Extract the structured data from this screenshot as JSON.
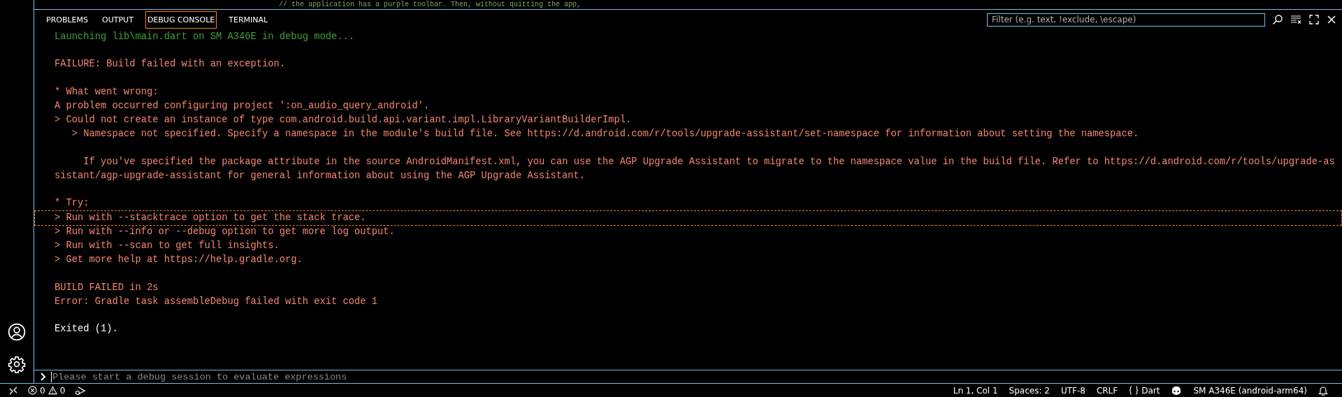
{
  "editor": {
    "code_line": "// the application has a purple toolbar. Then, without quitting the app,"
  },
  "panel": {
    "tabs": [
      {
        "label": "PROBLEMS",
        "selected": false
      },
      {
        "label": "OUTPUT",
        "selected": false
      },
      {
        "label": "DEBUG CONSOLE",
        "selected": true
      },
      {
        "label": "TERMINAL",
        "selected": false
      }
    ],
    "filter": {
      "placeholder": "Filter (e.g. text, !exclude, \\escape)"
    },
    "blocks": [
      {
        "lines": [
          {
            "kind": "info",
            "text": "Launching lib\\main.dart on SM A346E in debug mode...",
            "selected": false
          }
        ]
      },
      {
        "lines": [
          {
            "kind": "error",
            "text": "FAILURE: Build failed with an exception.",
            "selected": false
          }
        ]
      },
      {
        "lines": [
          {
            "kind": "error",
            "text": "* What went wrong:",
            "selected": false
          },
          {
            "kind": "error",
            "text": "A problem occurred configuring project ':on_audio_query_android'.",
            "selected": false
          },
          {
            "kind": "error",
            "text": "> Could not create an instance of type com.android.build.api.variant.impl.LibraryVariantBuilderImpl.",
            "selected": false
          },
          {
            "kind": "error",
            "text": "   > Namespace not specified. Specify a namespace in the module's build file. See https://d.android.com/r/tools/upgrade-assistant/set-namespace for information about setting the namespace.",
            "selected": false
          }
        ]
      },
      {
        "lines": [
          {
            "kind": "error",
            "text": "     If you've specified the package attribute in the source AndroidManifest.xml, you can use the AGP Upgrade Assistant to migrate to the namespace value in the build file. Refer to https://d.android.com/r/tools/upgrade-assistant/agp-upgrade-assistant for general information about using the AGP Upgrade Assistant.",
            "selected": false
          }
        ]
      },
      {
        "lines": [
          {
            "kind": "error",
            "text": "* Try:",
            "selected": false
          },
          {
            "kind": "error",
            "text": "> Run with --stacktrace option to get the stack trace.",
            "selected": true
          },
          {
            "kind": "error",
            "text": "> Run with --info or --debug option to get more log output.",
            "selected": false
          },
          {
            "kind": "error",
            "text": "> Run with --scan to get full insights.",
            "selected": false
          },
          {
            "kind": "error",
            "text": "> Get more help at https://help.gradle.org.",
            "selected": false
          }
        ]
      },
      {
        "lines": [
          {
            "kind": "error",
            "text": "BUILD FAILED in 2s",
            "selected": false
          },
          {
            "kind": "error",
            "text": "Error: Gradle task assembleDebug failed with exit code 1",
            "selected": false
          }
        ]
      },
      {
        "lines": [
          {
            "kind": "plain",
            "text": "Exited (1).",
            "selected": false
          }
        ]
      }
    ],
    "input": {
      "placeholder": "Please start a debug session to evaluate expressions"
    }
  },
  "status_bar": {
    "errors": "0",
    "warnings": "0",
    "items": [
      "Ln 1, Col 1",
      "Spaces: 2",
      "UTF-8",
      "CRLF"
    ],
    "language": "Dart",
    "device": "SM A346E (android-arm64)"
  }
}
